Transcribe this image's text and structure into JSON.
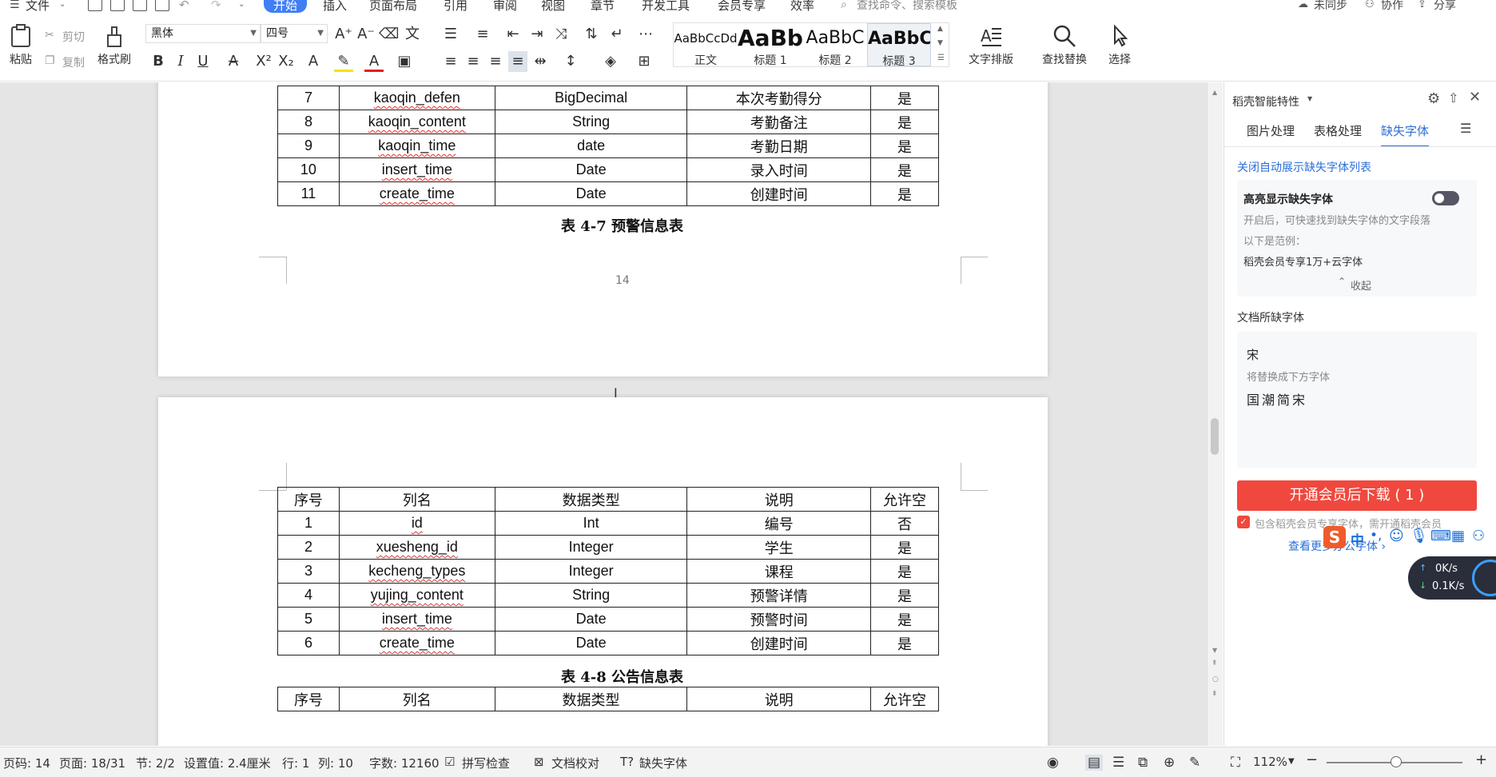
{
  "menu": {
    "items": [
      "文件",
      "开始",
      "插入",
      "页面布局",
      "引用",
      "审阅",
      "视图",
      "章节",
      "开发工具",
      "会员专享",
      "效率"
    ],
    "active": "开始",
    "search_placeholder": "查找命令、搜索模板",
    "sync": "未同步",
    "collab": "协作",
    "share": "分享"
  },
  "ribbon": {
    "paste": "粘贴",
    "cut": "剪切",
    "copy": "复制",
    "format_painter": "格式刷",
    "font_name": "黑体",
    "font_size": "四号",
    "styles": [
      {
        "sample": "AaBbCcDd",
        "label": "正文"
      },
      {
        "sample": "AaBb",
        "label": "标题 1"
      },
      {
        "sample": "AaBbC",
        "label": "标题 2"
      },
      {
        "sample": "AaBbC",
        "label": "标题 3"
      }
    ],
    "text_layout": "文字排版",
    "find_replace": "查找替换",
    "select": "选择"
  },
  "doc": {
    "table_a_rows": [
      [
        "7",
        "kaoqin_defen",
        "BigDecimal",
        "本次考勤得分",
        "是"
      ],
      [
        "8",
        "kaoqin_content",
        "String",
        "考勤备注",
        "是"
      ],
      [
        "9",
        "kaoqin_time",
        "date",
        "考勤日期",
        "是"
      ],
      [
        "10",
        "insert_time",
        "Date",
        "录入时间",
        "是"
      ],
      [
        "11",
        "create_time",
        "Date",
        "创建时间",
        "是"
      ]
    ],
    "caption_a": "表 4-7  预警信息表",
    "page_number": "14",
    "headers": [
      "序号",
      "列名",
      "数据类型",
      "说明",
      "允许空"
    ],
    "table_b_rows": [
      [
        "1",
        "id",
        "Int",
        "编号",
        "否"
      ],
      [
        "2",
        "xuesheng_id",
        "Integer",
        "学生",
        "是"
      ],
      [
        "3",
        "kecheng_types",
        "Integer",
        "课程",
        "是"
      ],
      [
        "4",
        "yujing_content",
        "String",
        "预警详情",
        "是"
      ],
      [
        "5",
        "insert_time",
        "Date",
        "预警时间",
        "是"
      ],
      [
        "6",
        "create_time",
        "Date",
        "创建时间",
        "是"
      ]
    ],
    "caption_b": "表 4-8  公告信息表"
  },
  "panel": {
    "title": "稻壳智能特性",
    "tabs": [
      "图片处理",
      "表格处理",
      "缺失字体"
    ],
    "active_tab": "缺失字体",
    "close_auto_link": "关闭自动展示缺失字体列表",
    "highlight_title": "高亮显示缺失字体",
    "highlight_desc": "开启后，可快速找到缺失字体的文字段落",
    "example_label": "以下是范例：",
    "example_text": "稻壳会员专享1万+云字体",
    "collapse": "收起",
    "missing_section": "文档所缺字体",
    "missing_font": "宋",
    "replace_hint": "将替换成下方字体",
    "replace_font": "国潮简宋",
    "cta": "开通会员后下载 ( 1 )",
    "included_note": "包含稻壳会员专享字体，需开通稻壳会员",
    "more_link": "查看更多办公字体 ›"
  },
  "netspeed": {
    "up": "0K/s",
    "down": "0.1K/s"
  },
  "status": {
    "page_code": "页码: 14",
    "page": "页面: 18/31",
    "section": "节: 2/2",
    "setting": "设置值: 2.4厘米",
    "row": "行: 1",
    "col": "列: 10",
    "word_count": "字数: 12160",
    "spell_check": "拼写检查",
    "doc_proof": "文档校对",
    "missing_fonts": "缺失字体",
    "zoom": "112%"
  }
}
